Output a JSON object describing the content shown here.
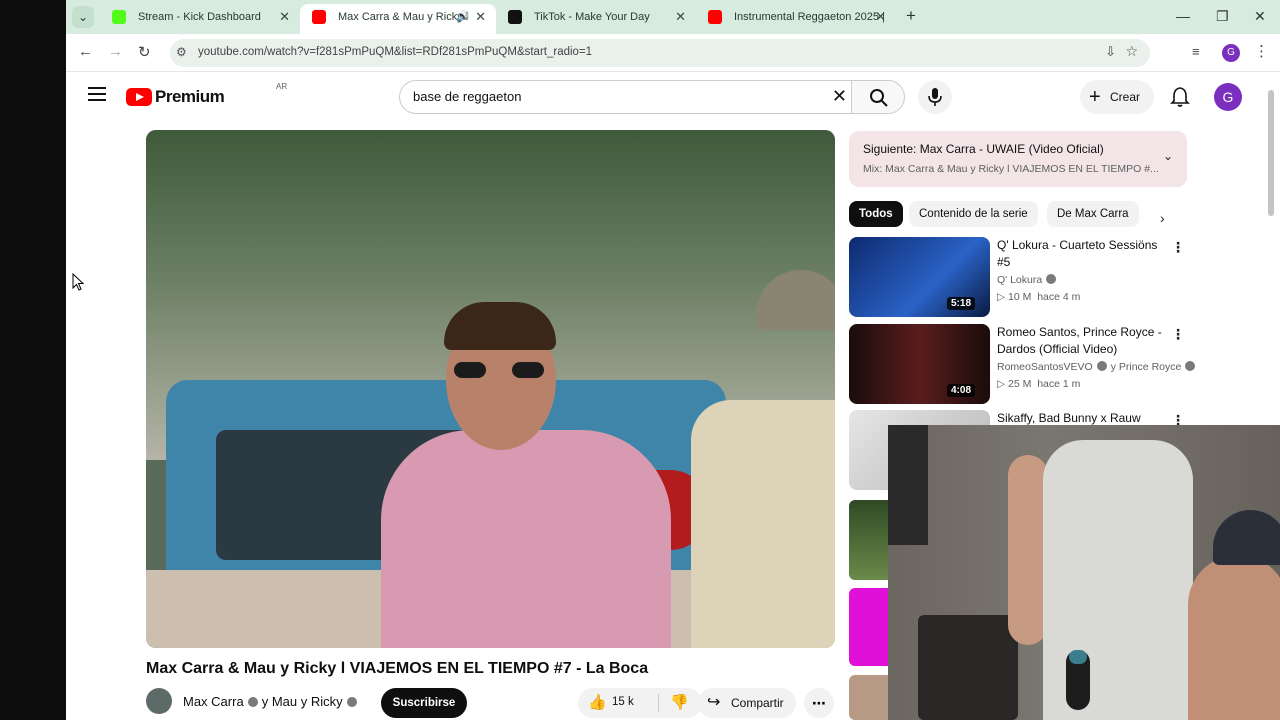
{
  "browser": {
    "tabs": [
      {
        "title": "Stream - Kick Dashboard",
        "favicon_color": "#53fc18",
        "active": false
      },
      {
        "title": "Max Carra & Mau y Ricky l",
        "favicon_color": "#ff0000",
        "active": true,
        "audio": true
      },
      {
        "title": "TikTok - Make Your Day",
        "favicon_color": "#111111",
        "active": false
      },
      {
        "title": "Instrumental Reggaeton 2025 |",
        "favicon_color": "#ff0000",
        "active": false
      }
    ],
    "url": "youtube.com/watch?v=f281sPmPuQM&list=RDf281sPmPuQM&start_radio=1",
    "profile_initial": "G"
  },
  "youtube": {
    "logo_text": "Premium",
    "country": "AR",
    "search_query": "base de reggaeton",
    "create_label": "Crear",
    "avatar_initial": "G",
    "accent_color": "#ff0000",
    "avatar_color": "#7b2fbf"
  },
  "video": {
    "title": "Max Carra & Mau y Ricky l VIAJEMOS EN EL TIEMPO #7 - La Boca",
    "channel": "Max Carra",
    "channel_connector": "y",
    "collab": "Mau y Ricky",
    "subscribe_label": "Suscribirse",
    "likes": "15 k",
    "share_label": "Compartir"
  },
  "playlist": {
    "next_label": "Siguiente: Max Carra - UWAIE (Video Oficial)",
    "mix_label": "Mix: Max Carra & Mau y Ricky l VIAJEMOS EN EL TIEMPO #..."
  },
  "chips": [
    "Todos",
    "Contenido de la serie",
    "De Max Carra"
  ],
  "recommendations": [
    {
      "title": "Q' Lokura - Cuarteto Sessiöns #5",
      "channel": "Q' Lokura",
      "views": "10 M",
      "age": "hace 4 m",
      "duration": "5:18",
      "thumb_color": "#1c3d8a"
    },
    {
      "title": "Romeo Santos, Prince Royce - Dardos (Official Video)",
      "channel": "RomeoSantosVEVO",
      "channel_extra": "y Prince Royce",
      "views": "25 M",
      "age": "hace 1 m",
      "duration": "4:08",
      "thumb_color": "#3a1414"
    },
    {
      "title": "Sikaffy, Bad Bunny x Rauw",
      "channel": "",
      "views": "",
      "age": "",
      "duration": "",
      "thumb_color": "#d8d8d8"
    }
  ],
  "icons": {
    "tab_search": "chevron-down-icon",
    "back": "arrow-left-icon",
    "forward": "arrow-right-icon",
    "reload": "reload-icon",
    "bookmark": "star-icon",
    "install": "install-icon",
    "menu": "more-vertical-icon"
  }
}
